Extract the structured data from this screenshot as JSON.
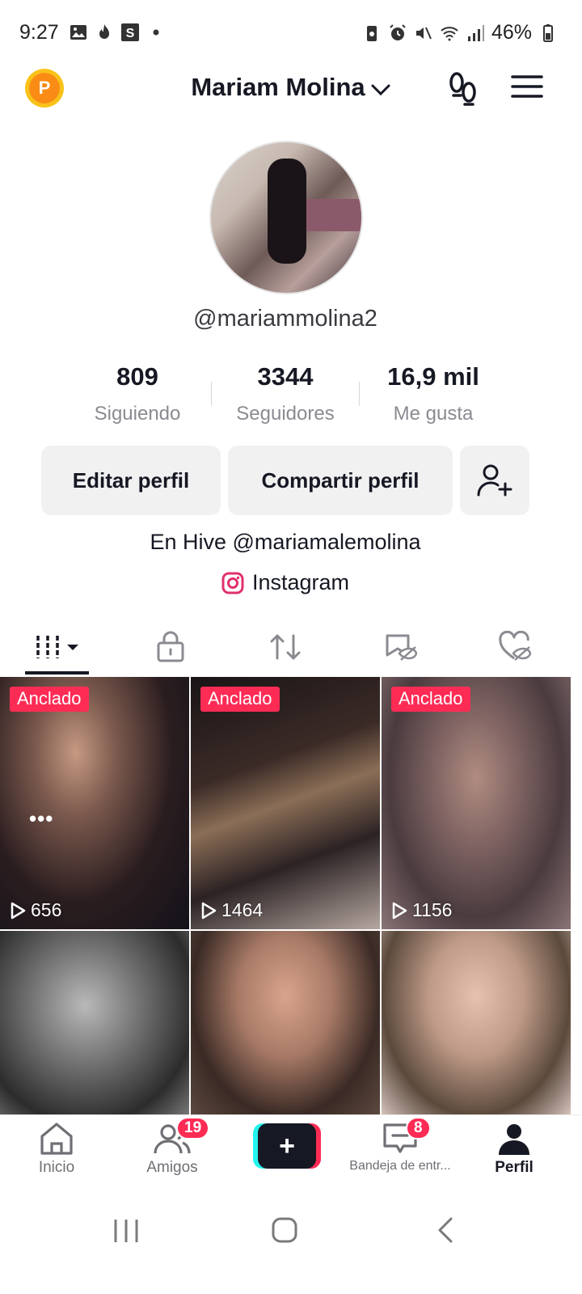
{
  "status_bar": {
    "time": "9:27",
    "battery": "46%"
  },
  "header": {
    "points_badge": "P",
    "title": "Mariam Molina"
  },
  "profile": {
    "username": "@mariammolina2",
    "stats": [
      {
        "value": "809",
        "label": "Siguiendo"
      },
      {
        "value": "3344",
        "label": "Seguidores"
      },
      {
        "value": "16,9 mil",
        "label": "Me gusta"
      }
    ],
    "edit_label": "Editar perfil",
    "share_label": "Compartir perfil",
    "bio": "En Hive @mariamalemolina",
    "instagram_label": "Instagram"
  },
  "videos": {
    "pinned_label": "Anclado",
    "items": [
      {
        "views": "656",
        "pinned": true
      },
      {
        "views": "1464",
        "pinned": true
      },
      {
        "views": "1156",
        "pinned": true
      },
      {
        "views": "",
        "pinned": false
      },
      {
        "views": "",
        "pinned": false
      },
      {
        "views": "",
        "pinned": false
      }
    ]
  },
  "bottom_nav": {
    "home": "Inicio",
    "friends": "Amigos",
    "friends_badge": "19",
    "inbox": "Bandeja de entr...",
    "inbox_badge": "8",
    "profile": "Perfil"
  },
  "colors": {
    "accent": "#fe2c55",
    "cyan": "#25f4ee",
    "text": "#161823"
  }
}
